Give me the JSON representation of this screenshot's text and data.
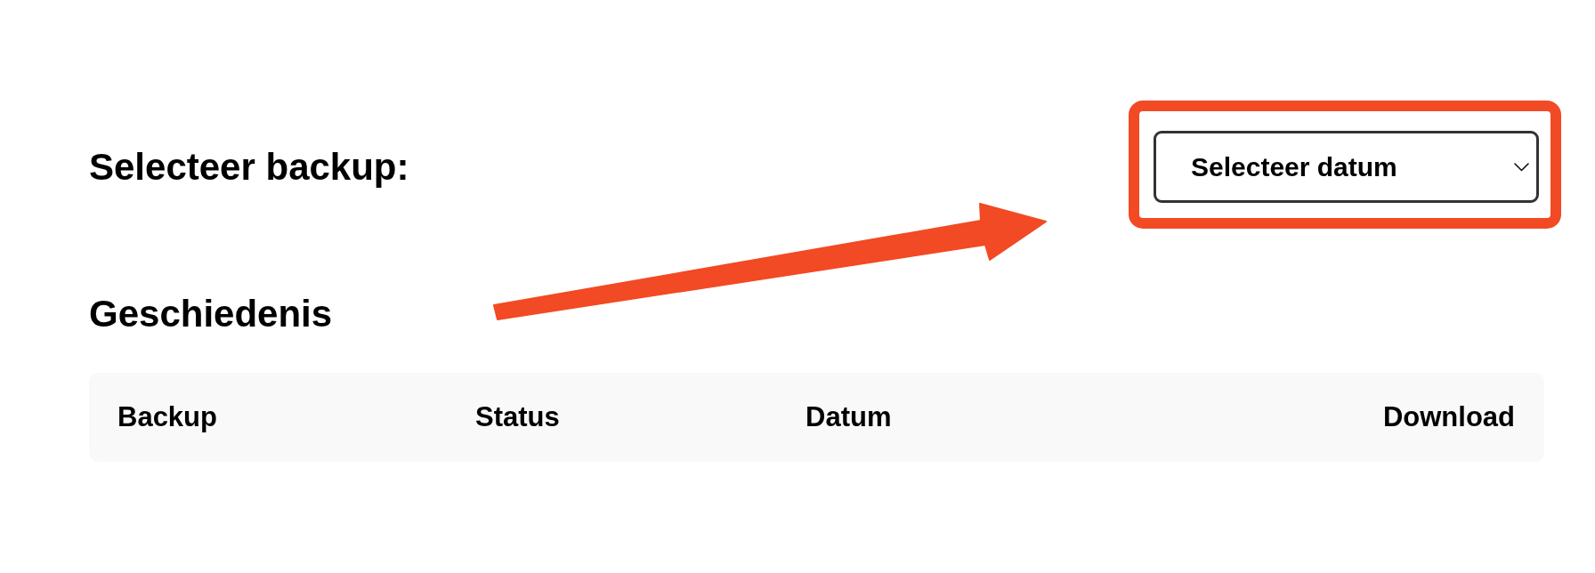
{
  "selection": {
    "label": "Selecteer backup:",
    "date_select": {
      "placeholder": "Selecteer datum",
      "highlighted": true
    }
  },
  "history": {
    "title": "Geschiedenis",
    "table": {
      "columns": [
        "Backup",
        "Status",
        "Datum",
        "Download"
      ]
    }
  },
  "annotations": [
    {
      "kind": "arrow"
    }
  ]
}
